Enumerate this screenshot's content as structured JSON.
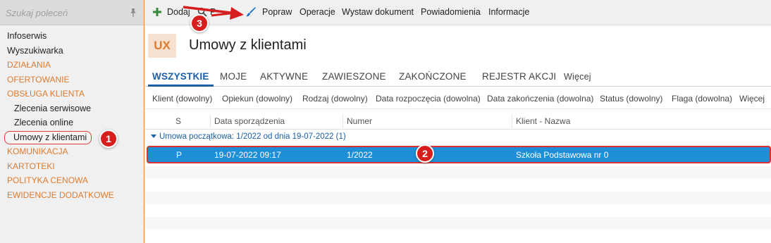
{
  "sidebar": {
    "search_placeholder": "Szukaj poleceń",
    "items": [
      {
        "label": "Infoserwis",
        "type": "item"
      },
      {
        "label": "Wyszukiwarka",
        "type": "item"
      },
      {
        "label": "DZIAŁANIA",
        "type": "section"
      },
      {
        "label": "OFERTOWANIE",
        "type": "section"
      },
      {
        "label": "OBSŁUGA KLIENTA",
        "type": "section"
      },
      {
        "label": "Zlecenia serwisowe",
        "type": "sub"
      },
      {
        "label": "Zlecenia online",
        "type": "sub"
      },
      {
        "label": "Umowy z klientami",
        "type": "sub-active"
      },
      {
        "label": "KOMUNIKACJA",
        "type": "section"
      },
      {
        "label": "KARTOTEKI",
        "type": "section"
      },
      {
        "label": "POLITYKA CENOWA",
        "type": "section"
      },
      {
        "label": "EWIDENCJE DODATKOWE",
        "type": "section"
      }
    ]
  },
  "toolbar": {
    "add_label": "Dodaj",
    "partial_label": "P",
    "edit_label": "Popraw",
    "operations_label": "Operacje",
    "issue_document_label": "Wystaw dokument",
    "notifications_label": "Powiadomienia",
    "info_label": "Informacje"
  },
  "header": {
    "badge": "UX",
    "title": "Umowy z klientami"
  },
  "tabs": [
    {
      "label": "WSZYSTKIE",
      "active": true
    },
    {
      "label": "MOJE"
    },
    {
      "label": "AKTYWNE"
    },
    {
      "label": "ZAWIESZONE"
    },
    {
      "label": "ZAKOŃCZONE"
    },
    {
      "label": "REJESTR AKCJI"
    },
    {
      "label": "Więcej"
    }
  ],
  "filters": [
    "Klient (dowolny)",
    "Opiekun (dowolny)",
    "Rodzaj (dowolny)",
    "Data rozpoczęcia (dowolna)",
    "Data zakończenia (dowolna)",
    "Status (dowolny)",
    "Flaga (dowolna)",
    "Więcej"
  ],
  "grid": {
    "columns": [
      "S",
      "Data sporządzenia",
      "Numer",
      "Klient - Nazwa"
    ],
    "group_label": "Umowa początkowa: 1/2022 od dnia 19-07-2022 (1)",
    "rows": [
      {
        "s": "P",
        "date": "19-07-2022 09:17",
        "number": "1/2022",
        "client": "Szkoła Podstawowa nr 0"
      }
    ]
  },
  "annotations": [
    "1",
    "2",
    "3"
  ],
  "colors": {
    "accent_orange": "#e07b2e",
    "accent_blue": "#1a5fa8",
    "selection_blue": "#1e8fd6",
    "annotation_red": "#d61e1e"
  }
}
